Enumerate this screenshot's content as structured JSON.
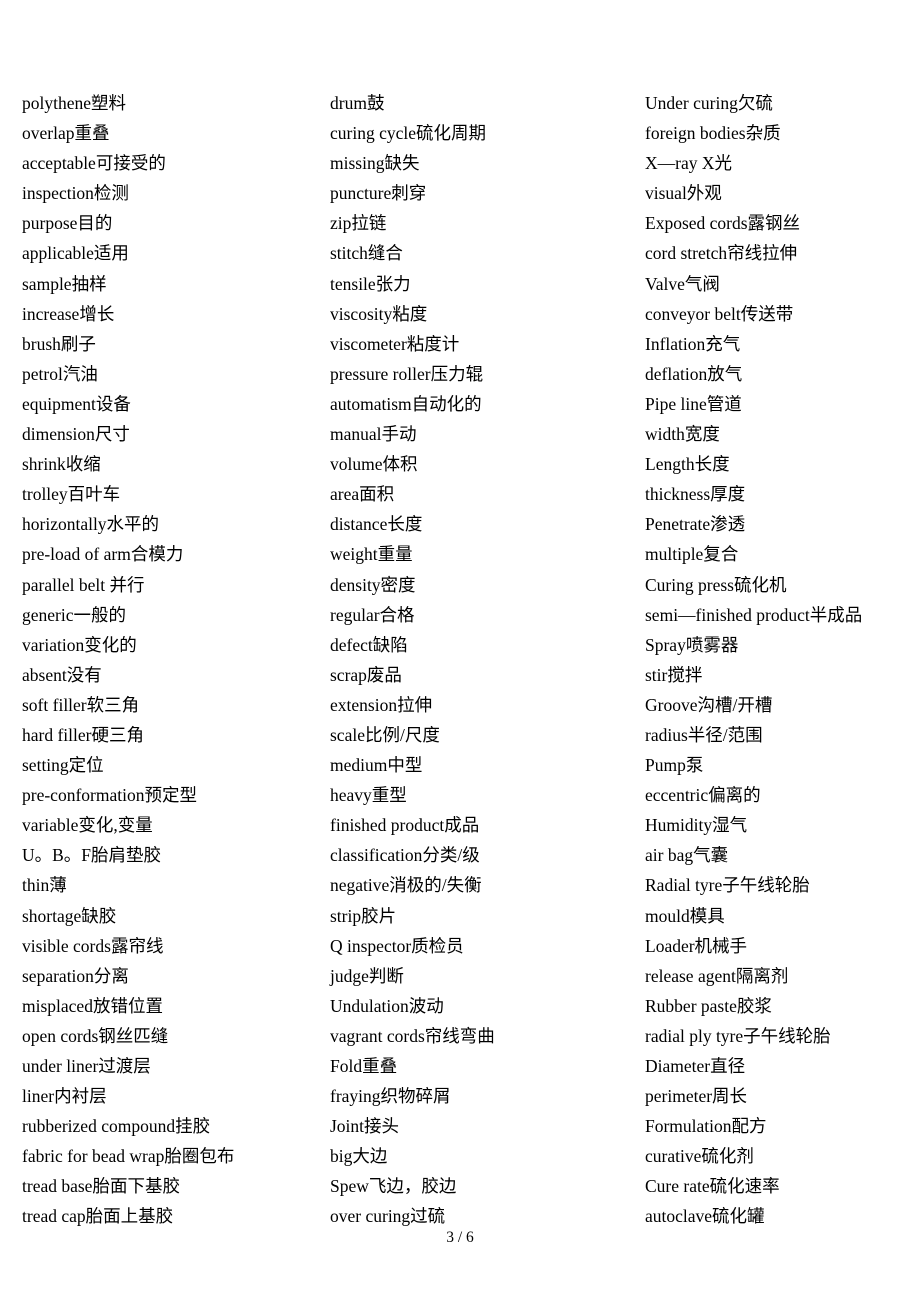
{
  "document": {
    "page_footer": "3 / 6",
    "columns": [
      {
        "index": 1,
        "entries": [
          "polythene塑料",
          "overlap重叠",
          "acceptable可接受的",
          "inspection检测",
          "purpose目的",
          "applicable适用",
          "sample抽样",
          "increase增长",
          "brush刷子",
          "petrol汽油",
          "equipment设备",
          "dimension尺寸",
          "shrink收缩",
          "trolley百叶车",
          "horizontally水平的",
          "pre-load of arm合模力",
          "parallel belt 并行",
          "generic一般的",
          "variation变化的",
          "absent没有",
          "soft filler软三角",
          "hard filler硬三角",
          "setting定位",
          "pre-conformation预定型",
          "variable变化,变量",
          "U。B。F胎肩垫胶",
          "thin薄",
          "shortage缺胶",
          "visible cords露帘线",
          "separation分离",
          "misplaced放错位置",
          "open cords钢丝匹缝",
          "under liner过渡层",
          "liner内衬层",
          "rubberized compound挂胶",
          "fabric for bead wrap胎圈包布",
          "tread base胎面下基胶",
          "tread cap胎面上基胶"
        ]
      },
      {
        "index": 2,
        "entries": [
          "drum鼓",
          "curing cycle硫化周期",
          "missing缺失",
          "puncture刺穿",
          "zip拉链",
          "stitch缝合",
          "tensile张力",
          "viscosity粘度",
          "viscometer粘度计",
          "pressure roller压力辊",
          "automatism自动化的",
          "manual手动",
          "volume体积",
          "area面积",
          "distance长度",
          "weight重量",
          "density密度",
          "regular合格",
          "defect缺陷",
          "scrap废品",
          "extension拉伸",
          "scale比例/尺度",
          "medium中型",
          "heavy重型",
          "finished product成品",
          "classification分类/级",
          "negative消极的/失衡",
          "strip胶片",
          "Q inspector质检员",
          "judge判断",
          "Undulation波动",
          "vagrant cords帘线弯曲",
          "Fold重叠",
          "fraying织物碎屑",
          "Joint接头",
          "big大边",
          "Spew飞边，胶边",
          "over curing过硫"
        ]
      },
      {
        "index": 3,
        "entries": [
          "Under curing欠硫",
          "foreign bodies杂质",
          "X—ray  X光",
          "visual外观",
          "Exposed cords露钢丝",
          "cord stretch帘线拉伸",
          "Valve气阀",
          "conveyor belt传送带",
          "Inflation充气",
          "deflation放气",
          "Pipe line管道",
          "width宽度",
          "Length长度",
          "thickness厚度",
          "Penetrate渗透",
          "multiple复合",
          "Curing press硫化机",
          "semi—finished product半成品",
          "Spray喷雾器",
          "stir搅拌",
          "Groove沟槽/开槽",
          "radius半径/范围",
          "Pump泵",
          "eccentric偏离的",
          "Humidity湿气",
          "air bag气囊",
          "Radial tyre子午线轮胎",
          "mould模具",
          "Loader机械手",
          "release agent隔离剂",
          "Rubber paste胶浆",
          "radial ply tyre子午线轮胎",
          "Diameter直径",
          "perimeter周长",
          "Formulation配方",
          "curative硫化剂",
          "Cure rate硫化速率",
          "autoclave硫化罐"
        ]
      }
    ]
  }
}
